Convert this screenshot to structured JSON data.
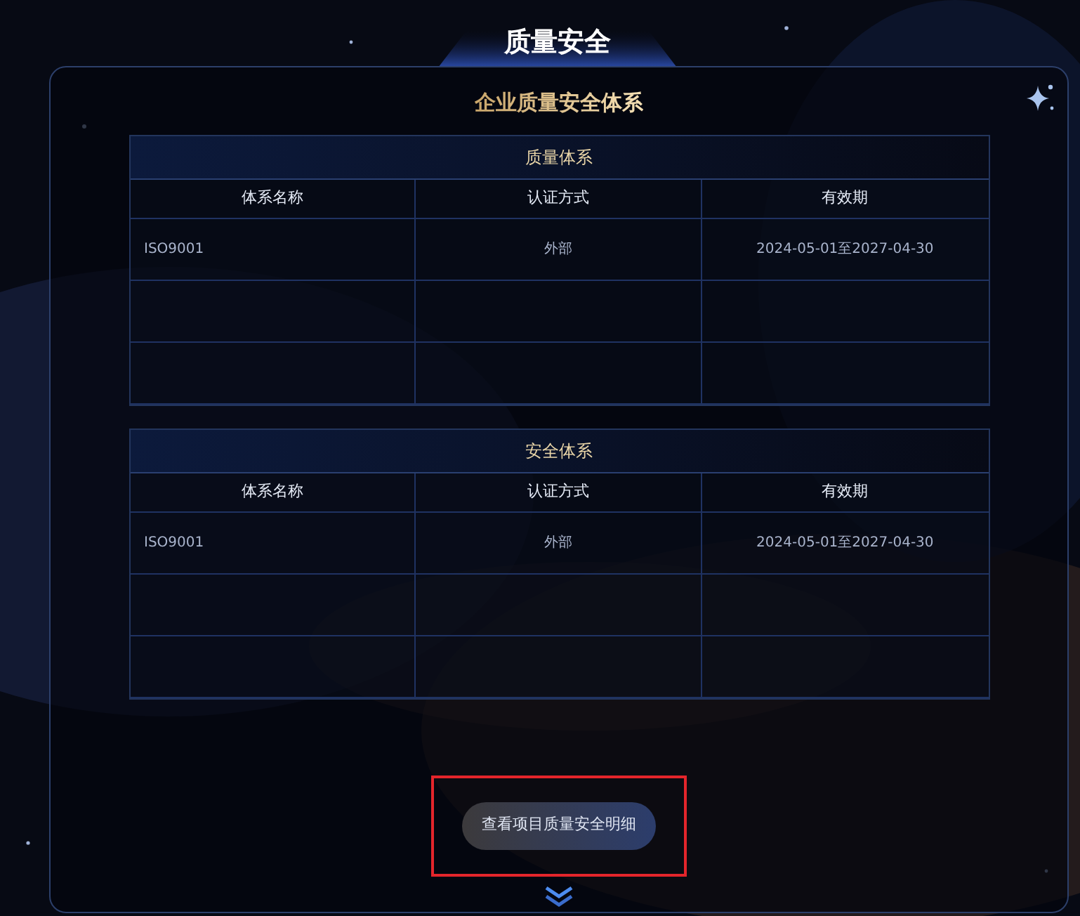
{
  "header": {
    "title": "质量安全"
  },
  "panel": {
    "title": "企业质量安全体系",
    "tables": [
      {
        "title": "质量体系",
        "columns": [
          "体系名称",
          "认证方式",
          "有效期"
        ],
        "rows": [
          [
            "ISO9001",
            "外部",
            "2024-05-01至2027-04-30"
          ]
        ]
      },
      {
        "title": "安全体系",
        "columns": [
          "体系名称",
          "认证方式",
          "有效期"
        ],
        "rows": [
          [
            "ISO9001",
            "外部",
            "2024-05-01至2027-04-30"
          ]
        ]
      }
    ],
    "button": {
      "label": "查看项目质量安全明细",
      "highlighted": true
    }
  }
}
